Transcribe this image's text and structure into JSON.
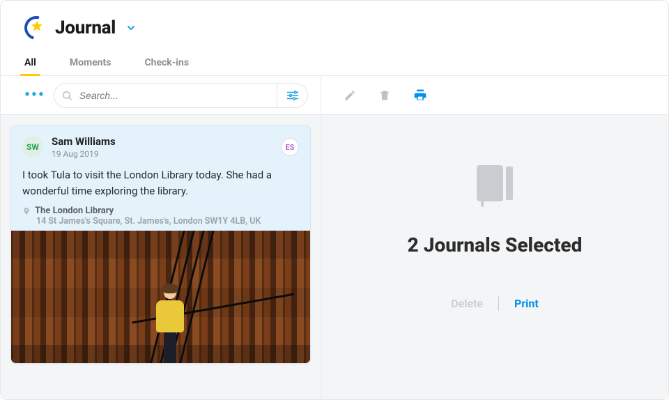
{
  "header": {
    "title": "Journal"
  },
  "tabs": [
    {
      "label": "All",
      "active": true
    },
    {
      "label": "Moments",
      "active": false
    },
    {
      "label": "Check-ins",
      "active": false
    }
  ],
  "toolbar": {
    "search_placeholder": "Search..."
  },
  "entry": {
    "author_initials": "SW",
    "author_name": "Sam Williams",
    "date": "19 Aug 2019",
    "share_initials": "ES",
    "body_text": "I took Tula to visit the London Library today. She had a wonderful time exploring the library.",
    "location_name": "The London Library",
    "location_address": "14 St James's Square, St. James's, London SW1Y 4LB, UK"
  },
  "detail": {
    "selected_title": "2 Journals Selected",
    "delete_label": "Delete",
    "print_label": "Print"
  }
}
